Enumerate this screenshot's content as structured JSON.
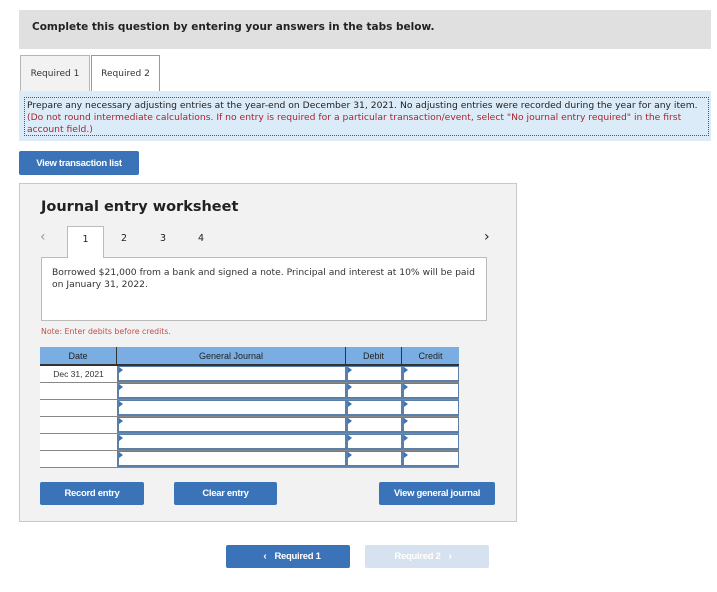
{
  "header": {
    "instruction": "Complete this question by entering your answers in the tabs below."
  },
  "tabs": [
    {
      "label": "Required 1",
      "active": false
    },
    {
      "label": "Required 2",
      "active": true
    }
  ],
  "instructions": {
    "main": "Prepare any necessary adjusting entries at the year-end on December 31, 2021. No adjusting entries were recorded during the year for any item.",
    "note": "(Do not round intermediate calculations. If no entry is required for a particular transaction/event, select \"No journal entry required\" in the first account field.)"
  },
  "buttons": {
    "view_transaction_list": "View transaction list",
    "record_entry": "Record entry",
    "clear_entry": "Clear entry",
    "view_general_journal": "View general journal"
  },
  "worksheet": {
    "title": "Journal entry worksheet",
    "prev_icon": "‹",
    "next_icon": "›",
    "entry_tabs": [
      "1",
      "2",
      "3",
      "4"
    ],
    "active_entry": "1",
    "description": "Borrowed $21,000 from a bank and signed a note. Principal and interest at 10% will be paid on January 31, 2022.",
    "note": "Note: Enter debits before credits.",
    "columns": [
      "Date",
      "General Journal",
      "Debit",
      "Credit"
    ],
    "rows": [
      {
        "date": "Dec 31, 2021",
        "account": "",
        "debit": "",
        "credit": ""
      },
      {
        "date": "",
        "account": "",
        "debit": "",
        "credit": ""
      },
      {
        "date": "",
        "account": "",
        "debit": "",
        "credit": ""
      },
      {
        "date": "",
        "account": "",
        "debit": "",
        "credit": ""
      },
      {
        "date": "",
        "account": "",
        "debit": "",
        "credit": ""
      },
      {
        "date": "",
        "account": "",
        "debit": "",
        "credit": ""
      }
    ]
  },
  "nav": {
    "prev_label": "Required 1",
    "next_label": "Required 2",
    "prev_icon": "‹",
    "next_icon": "›",
    "next_disabled": true
  },
  "colors": {
    "primary_button": "#3a73b8",
    "disabled_button": "#d6e2f0",
    "table_header": "#7aaee2",
    "note_red": "#a8262e"
  }
}
